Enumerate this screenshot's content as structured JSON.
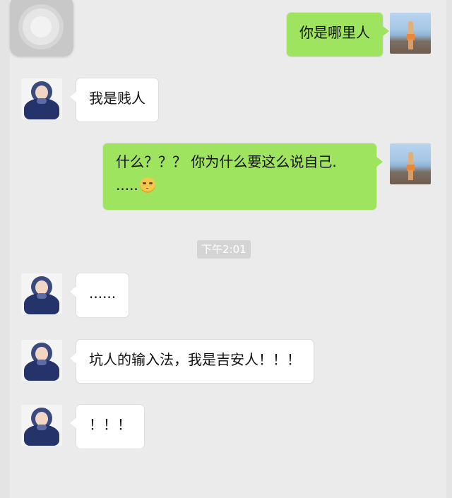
{
  "chat": {
    "timestamp": "下午2:01",
    "messages": [
      {
        "sender": "me",
        "text": "你是哪里人"
      },
      {
        "sender": "them",
        "text": "我是贱人"
      },
      {
        "sender": "me",
        "text_line1": "什么？？？ 你为什么要这么说自己.",
        "text_line2": ".....",
        "emoji": "eye-roll-emoji"
      },
      {
        "sender": "them",
        "text": "......"
      },
      {
        "sender": "them",
        "text": "坑人的输入法，我是吉安人！！！"
      },
      {
        "sender": "them",
        "text": "！！！"
      }
    ]
  },
  "colors": {
    "background": "#ebebeb",
    "sent_bubble": "#9fe45e",
    "received_bubble": "#ffffff",
    "timestamp_bg": "#d4d4d4"
  }
}
